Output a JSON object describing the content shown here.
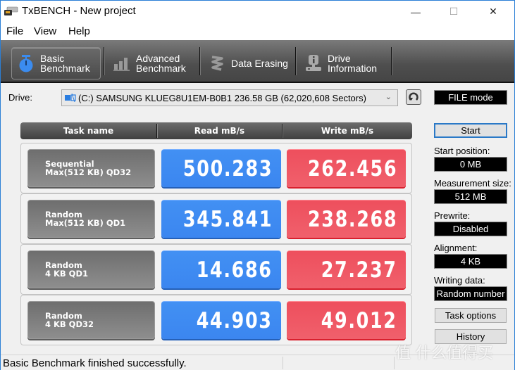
{
  "window": {
    "title": "TxBENCH - New project",
    "controls": {
      "minimize": "—",
      "maximize": "☐",
      "close": "✕"
    }
  },
  "menu": [
    "File",
    "View",
    "Help"
  ],
  "toolbar": {
    "tabs": [
      {
        "line1": "Basic",
        "line2": "Benchmark",
        "icon": "stopwatch-icon",
        "active": true
      },
      {
        "line1": "Advanced",
        "line2": "Benchmark",
        "icon": "bar-chart-icon",
        "active": false
      },
      {
        "line1": "Data Erasing",
        "line2": "",
        "icon": "spring-icon",
        "active": false
      },
      {
        "line1": "Drive",
        "line2": "Information",
        "icon": "drive-info-icon",
        "active": false
      }
    ]
  },
  "drive": {
    "label": "Drive:",
    "selected": "(C:) SAMSUNG KLUEG8U1EM-B0B1  236.58 GB (62,020,608 Sectors)",
    "mode": "FILE mode"
  },
  "table": {
    "headers": [
      "Task name",
      "Read mB/s",
      "Write mB/s"
    ],
    "rows": [
      {
        "task1": "Sequential",
        "task2": "Max(512 KB) QD32",
        "read": "500.283",
        "write": "262.456"
      },
      {
        "task1": "Random",
        "task2": "Max(512 KB) QD1",
        "read": "345.841",
        "write": "238.268"
      },
      {
        "task1": "Random",
        "task2": "4 KB QD1",
        "read": "14.686",
        "write": "27.237"
      },
      {
        "task1": "Random",
        "task2": "4 KB QD32",
        "read": "44.903",
        "write": "49.012"
      }
    ]
  },
  "panel": {
    "start": "Start",
    "start_position_label": "Start position:",
    "start_position": "0 MB",
    "measurement_size_label": "Measurement size:",
    "measurement_size": "512 MB",
    "prewrite_label": "Prewrite:",
    "prewrite": "Disabled",
    "alignment_label": "Alignment:",
    "alignment": "4 KB",
    "writing_data_label": "Writing data:",
    "writing_data": "Random number",
    "task_options": "Task options",
    "history": "History"
  },
  "status": {
    "text": "Basic Benchmark finished successfully."
  },
  "watermark": "值 什么值得买",
  "colors": {
    "read": "#3d8af2",
    "write": "#ef5361",
    "accent": "#2a79c7",
    "active_icon": "#3b8cf0"
  }
}
